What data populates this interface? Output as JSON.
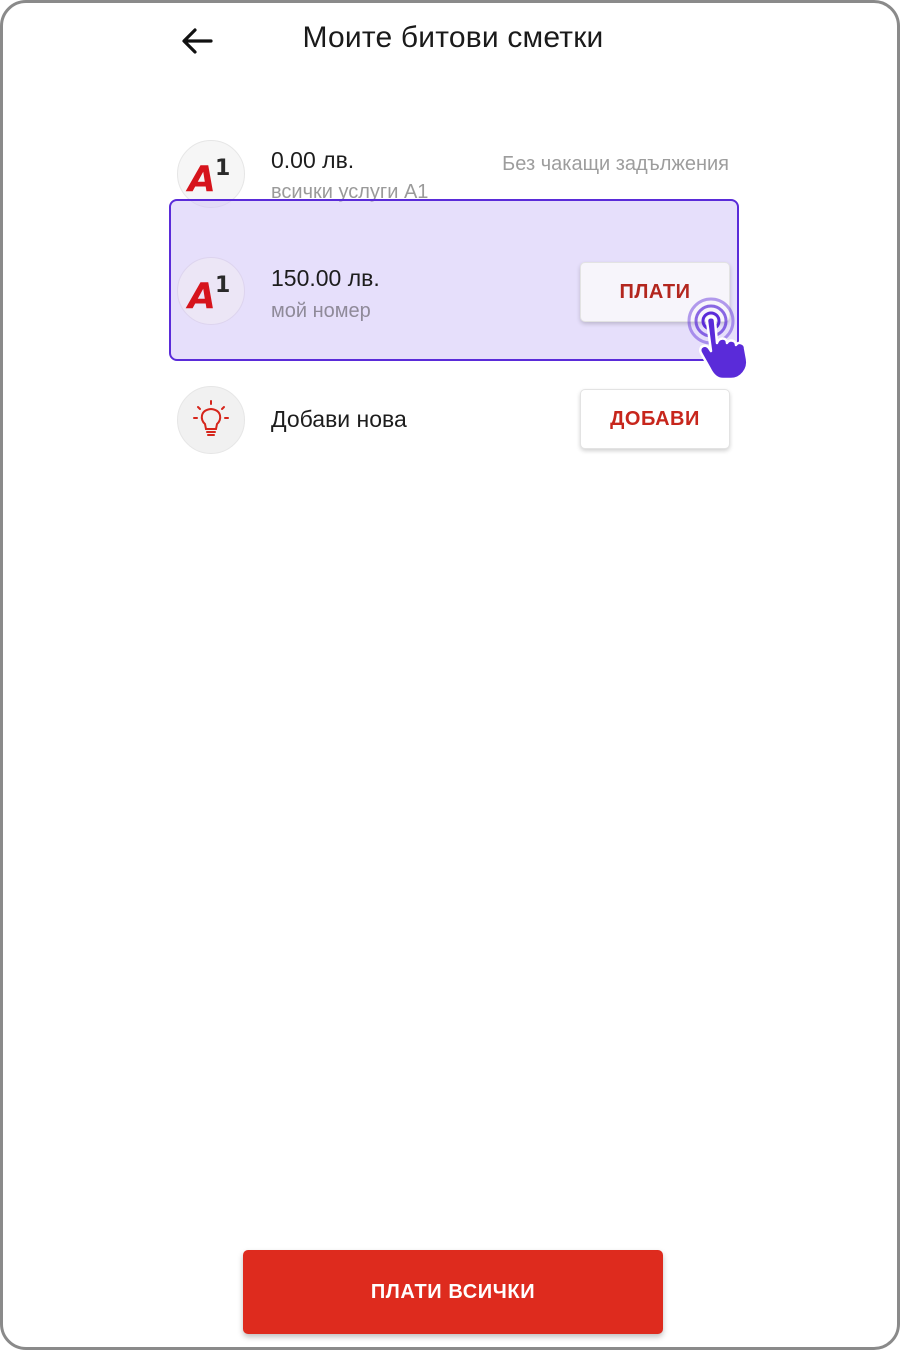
{
  "header": {
    "title": "Моите битови сметки"
  },
  "accounts": [
    {
      "amount": "0.00 лв.",
      "subtitle": "всички услуги A1",
      "status": "Без чакащи задължения",
      "logo": "A1"
    },
    {
      "amount": "150.00 лв.",
      "subtitle": "мой номер",
      "action_label": "ПЛАТИ",
      "logo": "A1"
    }
  ],
  "add_new": {
    "label": "Добави нова",
    "action_label": "ДОБАВИ",
    "icon": "lightbulb-icon"
  },
  "footer": {
    "pay_all_label": "ПЛАТИ ВСИЧКИ"
  },
  "colors": {
    "brand_red": "#de2b1e",
    "highlight_fill": "#d1c4f7",
    "highlight_border": "#5a2bd9",
    "cursor": "#5a2bd9"
  }
}
